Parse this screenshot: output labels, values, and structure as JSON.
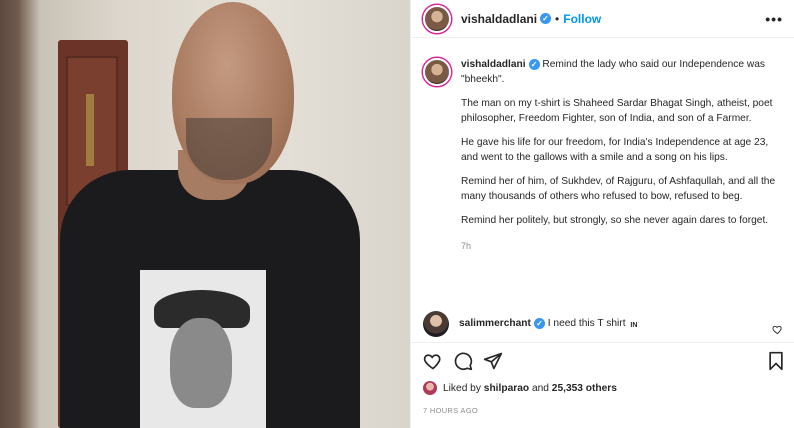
{
  "post": {
    "author": "vishaldadlani",
    "follow_label": "Follow",
    "separator": "•",
    "more_label": "•••",
    "verified_mark": "✓",
    "caption": {
      "first_line": "Remind the lady who said our Independence was \"bheekh\".",
      "paragraphs": [
        "The man on my t-shirt is Shaheed Sardar Bhagat Singh, atheist, poet philosopher, Freedom Fighter, son of India, and son of a Farmer.",
        "He gave his life for our freedom, for India's Independence at age 23, and went to the gallows with a smile and a song on his lips.",
        "Remind her of him, of Sukhdev, of Rajguru, of Ashfaqullah, and all the many thousands of others who refused to bow, refused to beg.",
        "Remind her politely, but strongly, so she never again dares to forget."
      ],
      "time": "7h"
    },
    "comment": {
      "user": "salimmerchant",
      "text": "I need this T shirt",
      "emoji": "IN"
    },
    "likes": {
      "prefix": "Liked by",
      "user": "shilparao",
      "conj": "and",
      "count": "25,353 others"
    },
    "timestamp": "7 HOURS AGO"
  },
  "icons": {
    "like": "heart-icon",
    "comment": "comment-icon",
    "share": "share-icon",
    "save": "bookmark-icon",
    "verified": "verified-badge-icon",
    "more": "more-options-icon"
  },
  "colors": {
    "link": "#0095f6",
    "verified": "#3897f0",
    "text": "#262626",
    "muted": "#8e8e8e"
  }
}
